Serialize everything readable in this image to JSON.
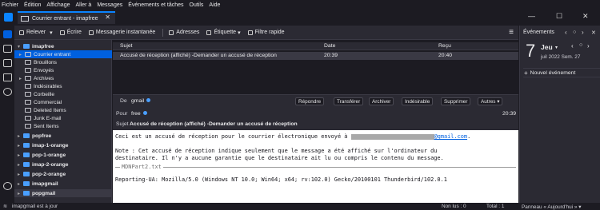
{
  "menu": [
    "Fichier",
    "Édition",
    "Affichage",
    "Aller à",
    "Messages",
    "Événements et tâches",
    "Outils",
    "Aide"
  ],
  "tab": {
    "title": "Courrier entrant - imapfree",
    "close": "✕"
  },
  "window_controls": {
    "minimize": "—",
    "maximize": "☐",
    "close": "✕"
  },
  "toolbar": {
    "reply": "Relever",
    "reply_dropdown": "▾",
    "write": "Écrire",
    "chat": "Messagerie instantanée",
    "addresses": "Adresses",
    "tag": "Étiquette",
    "tag_dropdown": "▾",
    "filter": "Filtre rapide",
    "menu": "≡"
  },
  "folders": [
    {
      "label": "imapfree",
      "kind": "account",
      "twisty": "▾"
    },
    {
      "label": "Courrier entrant",
      "kind": "folder",
      "selected": true,
      "twisty": "▸"
    },
    {
      "label": "Brouillons",
      "kind": "folder"
    },
    {
      "label": "Envoyés",
      "kind": "folder"
    },
    {
      "label": "Archives",
      "kind": "folder",
      "twisty": "▸"
    },
    {
      "label": "Indésirables",
      "kind": "folder"
    },
    {
      "label": "Corbeille",
      "kind": "folder"
    },
    {
      "label": "Commercial",
      "kind": "folder"
    },
    {
      "label": "Deleted Items",
      "kind": "folder"
    },
    {
      "label": "Junk E-mail",
      "kind": "folder"
    },
    {
      "label": "Sent Items",
      "kind": "folder"
    },
    {
      "label": "popfree",
      "kind": "account",
      "twisty": "▸"
    },
    {
      "label": "imap-1-orange",
      "kind": "account",
      "twisty": "▸"
    },
    {
      "label": "pop-1-orange",
      "kind": "account",
      "twisty": "▸"
    },
    {
      "label": "imap-2-orange",
      "kind": "account",
      "twisty": "▸"
    },
    {
      "label": "pop-2-orange",
      "kind": "account",
      "twisty": "▸"
    },
    {
      "label": "imapgmail",
      "kind": "account",
      "twisty": "▸"
    },
    {
      "label": "popgmail",
      "kind": "account",
      "twisty": "▸"
    }
  ],
  "thread_columns": {
    "subject": "Sujet",
    "date": "Date",
    "received": "Reçu"
  },
  "thread_rows": [
    {
      "subject": "Accusé de réception (affiché) -Demander un accusé de réception",
      "date": "20:39",
      "received": "20:40"
    }
  ],
  "message": {
    "from_label": "De",
    "from": "gmail",
    "to_label": "Pour",
    "to": "free",
    "time": "20:39",
    "subject_label": "Sujet",
    "subject": "Accusé de réception (affiché) -Demander un accusé de réception",
    "buttons": {
      "reply": "Répondre",
      "forward": "Transférer",
      "archive": "Archiver",
      "junk": "Indésirable",
      "delete": "Supprimer",
      "more": "Autres ▾"
    },
    "body": {
      "line1": "Ceci est un accusé de réception pour le courrier électronique envoyé à",
      "email_domain": "@gmail.com",
      "line1_end": ".",
      "line2": "Note : Cet accusé de réception indique seulement que le message a été affiché sur l'ordinateur du",
      "line3": "destinataire. Il n'y a aucune garantie que le destinataire ait lu ou compris le contenu du message.",
      "attachment": "MDNPart2.txt",
      "line4": "Reporting-UA: Mozilla/5.0 (Windows NT 10.0; Win64; x64; rv:102.0) Gecko/20100101 Thunderbird/102.0.1"
    }
  },
  "today": {
    "title": "Événements",
    "nav": {
      "prev": "‹",
      "today": "○",
      "next": "›",
      "close": "✕"
    },
    "day": "7",
    "weekday": "Jeu",
    "weekday_dropdown": "▾",
    "month_week": "juil 2022  Sem. 27",
    "new_event": "Nouvel événement"
  },
  "status": {
    "account": "imapgmail est à jour",
    "unread": "Non lus : 0",
    "total": "Total : 1",
    "panel": "Panneau « Aujourd'hui » ▾"
  },
  "colors": {
    "accent": "#0a84ff",
    "selection": "#0060df",
    "background": "#1c1b22",
    "panel": "#2b2a33"
  }
}
